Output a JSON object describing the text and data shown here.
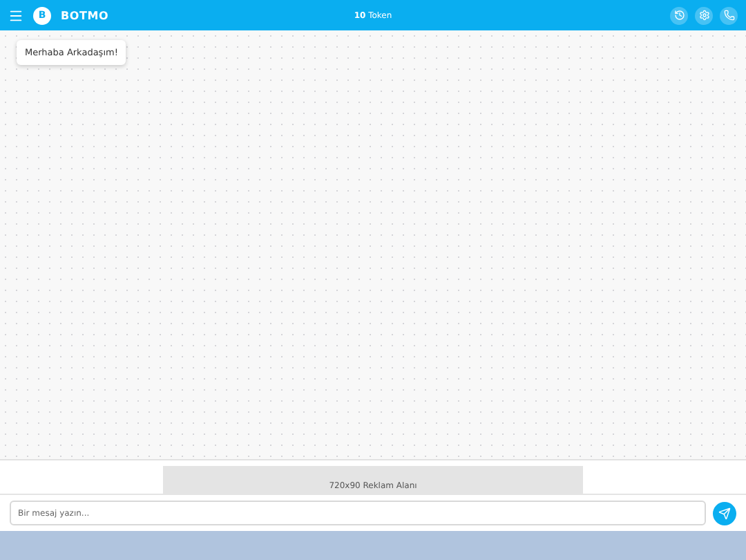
{
  "header": {
    "logo_letter": "B",
    "brand": "BOTMO",
    "tokens_count": "10",
    "tokens_label": "Token"
  },
  "messages": [
    {
      "text": "Merhaba Arkadaşım!"
    }
  ],
  "ad": {
    "text": "720x90 Reklam Alanı"
  },
  "composer": {
    "placeholder": "Bir mesaj yazın..."
  }
}
